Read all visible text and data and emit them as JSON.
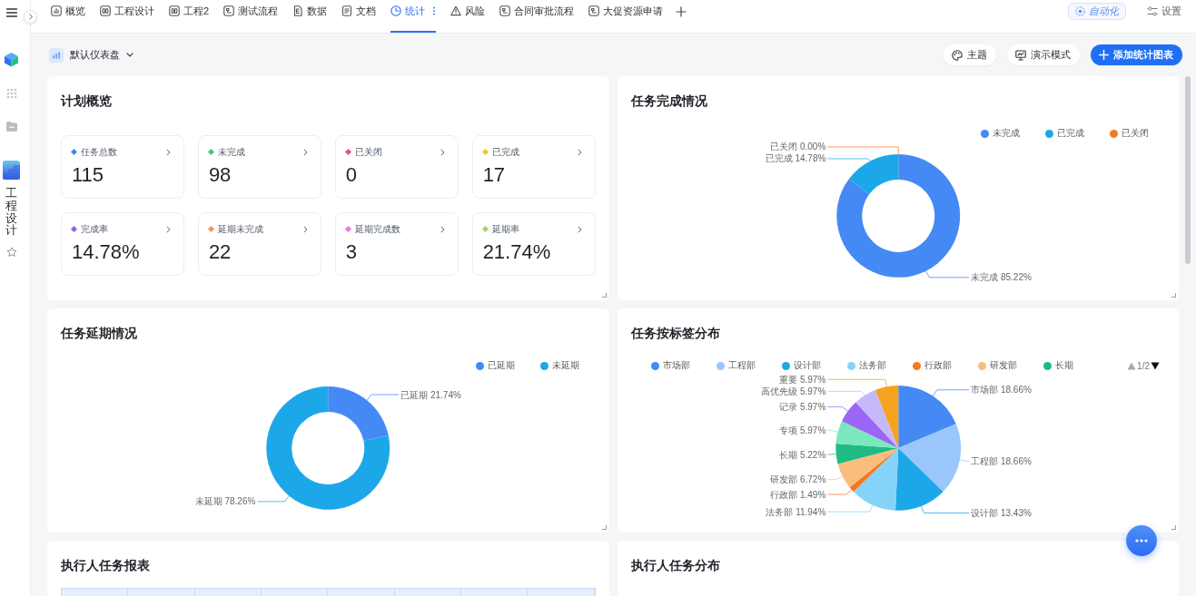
{
  "sidebar": {
    "app_label": "工程设计"
  },
  "tabs": [
    {
      "label": "概览",
      "kind": "overview",
      "selected": false
    },
    {
      "label": "工程设计",
      "kind": "board",
      "selected": false
    },
    {
      "label": "工程2",
      "kind": "board",
      "selected": false
    },
    {
      "label": "测试流程",
      "kind": "flow",
      "selected": false
    },
    {
      "label": "数据",
      "kind": "data",
      "selected": false
    },
    {
      "label": "文档",
      "kind": "doc",
      "selected": false
    },
    {
      "label": "统计",
      "kind": "stats",
      "selected": true
    },
    {
      "label": "风险",
      "kind": "risk",
      "selected": false
    },
    {
      "label": "合同审批流程",
      "kind": "flow",
      "selected": false
    },
    {
      "label": "大促资源申请",
      "kind": "flow",
      "selected": false
    }
  ],
  "top_actions": [
    {
      "label": "自动化",
      "kind": "automation"
    },
    {
      "label": "设置",
      "kind": "settings"
    }
  ],
  "dashboard": {
    "name": "默认仪表盘"
  },
  "toolbar": [
    {
      "label": "主题",
      "kind": "theme"
    },
    {
      "label": "演示模式",
      "kind": "present"
    },
    {
      "label": "添加统计图表",
      "kind": "add"
    }
  ],
  "cards": [
    {
      "kind": "stats",
      "title": "计划概览",
      "resize_handle": true,
      "stats": [
        {
          "label": "任务总数",
          "value": "115",
          "color": "#3c8cf5"
        },
        {
          "label": "未完成",
          "value": "98",
          "color": "#48c774"
        },
        {
          "label": "已关闭",
          "value": "0",
          "color": "#ef4f6b"
        },
        {
          "label": "已完成",
          "value": "17",
          "color": "#f7c21b"
        },
        {
          "label": "完成率",
          "value": "14.78%",
          "color": "#9a5ce6"
        },
        {
          "label": "延期未完成",
          "value": "22",
          "color": "#ef9a5e"
        },
        {
          "label": "延期完成数",
          "value": "3",
          "color": "#e27bdc"
        },
        {
          "label": "延期率",
          "value": "21.74%",
          "color": "#9fd56a"
        }
      ]
    },
    {
      "kind": "chart",
      "title": "任务完成情况",
      "resize_handle": true,
      "legend": [
        {
          "label": "未完成",
          "color": "#4589f5"
        },
        {
          "label": "已完成",
          "color": "#1ca8e8"
        },
        {
          "label": "已关闭",
          "color": "#f57a1f"
        }
      ],
      "chart_data": {
        "type": "donut",
        "categories": [
          "未完成",
          "已完成",
          "已关闭"
        ],
        "values": [
          85.22,
          14.78,
          0
        ],
        "colors": [
          "#4589f5",
          "#1ca8e8",
          "#f57a1f"
        ],
        "data_labels": true,
        "value_labels": [
          "85.22%",
          "14.78%",
          "0.00%"
        ]
      }
    },
    {
      "kind": "chart",
      "title": "任务延期情况",
      "resize_handle": true,
      "legend": [
        {
          "label": "已延期",
          "color": "#4589f5"
        },
        {
          "label": "未延期",
          "color": "#1ca8e8"
        }
      ],
      "chart_data": {
        "type": "donut",
        "categories": [
          "已延期",
          "未延期"
        ],
        "values": [
          21.74,
          78.26
        ],
        "colors": [
          "#4589f5",
          "#1ca8e8"
        ],
        "data_labels": true,
        "value_labels": [
          "21.74%",
          "78.26%"
        ]
      }
    },
    {
      "kind": "chart",
      "title": "任务按标签分布",
      "resize_handle": true,
      "legend": [
        {
          "label": "市场部",
          "color": "#4589f5"
        },
        {
          "label": "工程部",
          "color": "#9ac6fb"
        },
        {
          "label": "设计部",
          "color": "#1ca8e8"
        },
        {
          "label": "法务部",
          "color": "#86d3fa"
        },
        {
          "label": "行政部",
          "color": "#f5771f"
        },
        {
          "label": "研发部",
          "color": "#fbbd7e"
        },
        {
          "label": "长期",
          "color": "#20bb84"
        }
      ],
      "legend_pager": {
        "page": "1/2",
        "prev_disabled": true,
        "next_disabled": false
      },
      "chart_data": {
        "type": "pie",
        "categories": [
          "市场部",
          "工程部",
          "设计部",
          "法务部",
          "行政部",
          "研发部",
          "长期",
          "专项",
          "记录",
          "高优先级",
          "重要"
        ],
        "values": [
          18.66,
          18.66,
          13.43,
          11.94,
          1.49,
          6.72,
          5.22,
          5.97,
          5.97,
          5.97,
          5.97
        ],
        "colors": [
          "#4589f5",
          "#9ac6fb",
          "#1ca8e8",
          "#86d3fa",
          "#f5771f",
          "#fbbd7e",
          "#20bb84",
          "#7be7bd",
          "#9966f6",
          "#c5b9fc",
          "#f5a31c"
        ],
        "data_labels": true,
        "value_labels": [
          "18.66%",
          "18.66%",
          "13.43%",
          "11.94%",
          "1.49%",
          "6.72%",
          "5.22%",
          "5.97%",
          "5.97%",
          "5.97%",
          "5.97%"
        ]
      }
    },
    {
      "kind": "table",
      "title": "执行人任务报表"
    },
    {
      "kind": "blank",
      "title": "执行人任务分布"
    }
  ]
}
